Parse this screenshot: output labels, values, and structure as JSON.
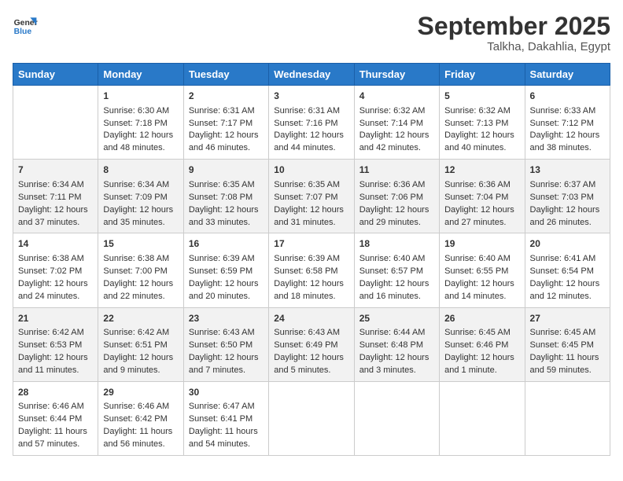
{
  "logo": {
    "line1": "General",
    "line2": "Blue"
  },
  "title": "September 2025",
  "subtitle": "Talkha, Dakahlia, Egypt",
  "days_header": [
    "Sunday",
    "Monday",
    "Tuesday",
    "Wednesday",
    "Thursday",
    "Friday",
    "Saturday"
  ],
  "weeks": [
    [
      {
        "day": "",
        "empty": true
      },
      {
        "day": "1",
        "sunrise": "6:30 AM",
        "sunset": "7:18 PM",
        "daylight": "12 hours and 48 minutes."
      },
      {
        "day": "2",
        "sunrise": "6:31 AM",
        "sunset": "7:17 PM",
        "daylight": "12 hours and 46 minutes."
      },
      {
        "day": "3",
        "sunrise": "6:31 AM",
        "sunset": "7:16 PM",
        "daylight": "12 hours and 44 minutes."
      },
      {
        "day": "4",
        "sunrise": "6:32 AM",
        "sunset": "7:14 PM",
        "daylight": "12 hours and 42 minutes."
      },
      {
        "day": "5",
        "sunrise": "6:32 AM",
        "sunset": "7:13 PM",
        "daylight": "12 hours and 40 minutes."
      },
      {
        "day": "6",
        "sunrise": "6:33 AM",
        "sunset": "7:12 PM",
        "daylight": "12 hours and 38 minutes."
      }
    ],
    [
      {
        "day": "7",
        "sunrise": "6:34 AM",
        "sunset": "7:11 PM",
        "daylight": "12 hours and 37 minutes."
      },
      {
        "day": "8",
        "sunrise": "6:34 AM",
        "sunset": "7:09 PM",
        "daylight": "12 hours and 35 minutes."
      },
      {
        "day": "9",
        "sunrise": "6:35 AM",
        "sunset": "7:08 PM",
        "daylight": "12 hours and 33 minutes."
      },
      {
        "day": "10",
        "sunrise": "6:35 AM",
        "sunset": "7:07 PM",
        "daylight": "12 hours and 31 minutes."
      },
      {
        "day": "11",
        "sunrise": "6:36 AM",
        "sunset": "7:06 PM",
        "daylight": "12 hours and 29 minutes."
      },
      {
        "day": "12",
        "sunrise": "6:36 AM",
        "sunset": "7:04 PM",
        "daylight": "12 hours and 27 minutes."
      },
      {
        "day": "13",
        "sunrise": "6:37 AM",
        "sunset": "7:03 PM",
        "daylight": "12 hours and 26 minutes."
      }
    ],
    [
      {
        "day": "14",
        "sunrise": "6:38 AM",
        "sunset": "7:02 PM",
        "daylight": "12 hours and 24 minutes."
      },
      {
        "day": "15",
        "sunrise": "6:38 AM",
        "sunset": "7:00 PM",
        "daylight": "12 hours and 22 minutes."
      },
      {
        "day": "16",
        "sunrise": "6:39 AM",
        "sunset": "6:59 PM",
        "daylight": "12 hours and 20 minutes."
      },
      {
        "day": "17",
        "sunrise": "6:39 AM",
        "sunset": "6:58 PM",
        "daylight": "12 hours and 18 minutes."
      },
      {
        "day": "18",
        "sunrise": "6:40 AM",
        "sunset": "6:57 PM",
        "daylight": "12 hours and 16 minutes."
      },
      {
        "day": "19",
        "sunrise": "6:40 AM",
        "sunset": "6:55 PM",
        "daylight": "12 hours and 14 minutes."
      },
      {
        "day": "20",
        "sunrise": "6:41 AM",
        "sunset": "6:54 PM",
        "daylight": "12 hours and 12 minutes."
      }
    ],
    [
      {
        "day": "21",
        "sunrise": "6:42 AM",
        "sunset": "6:53 PM",
        "daylight": "12 hours and 11 minutes."
      },
      {
        "day": "22",
        "sunrise": "6:42 AM",
        "sunset": "6:51 PM",
        "daylight": "12 hours and 9 minutes."
      },
      {
        "day": "23",
        "sunrise": "6:43 AM",
        "sunset": "6:50 PM",
        "daylight": "12 hours and 7 minutes."
      },
      {
        "day": "24",
        "sunrise": "6:43 AM",
        "sunset": "6:49 PM",
        "daylight": "12 hours and 5 minutes."
      },
      {
        "day": "25",
        "sunrise": "6:44 AM",
        "sunset": "6:48 PM",
        "daylight": "12 hours and 3 minutes."
      },
      {
        "day": "26",
        "sunrise": "6:45 AM",
        "sunset": "6:46 PM",
        "daylight": "12 hours and 1 minute."
      },
      {
        "day": "27",
        "sunrise": "6:45 AM",
        "sunset": "6:45 PM",
        "daylight": "11 hours and 59 minutes."
      }
    ],
    [
      {
        "day": "28",
        "sunrise": "6:46 AM",
        "sunset": "6:44 PM",
        "daylight": "11 hours and 57 minutes."
      },
      {
        "day": "29",
        "sunrise": "6:46 AM",
        "sunset": "6:42 PM",
        "daylight": "11 hours and 56 minutes."
      },
      {
        "day": "30",
        "sunrise": "6:47 AM",
        "sunset": "6:41 PM",
        "daylight": "11 hours and 54 minutes."
      },
      {
        "day": "",
        "empty": true
      },
      {
        "day": "",
        "empty": true
      },
      {
        "day": "",
        "empty": true
      },
      {
        "day": "",
        "empty": true
      }
    ]
  ]
}
